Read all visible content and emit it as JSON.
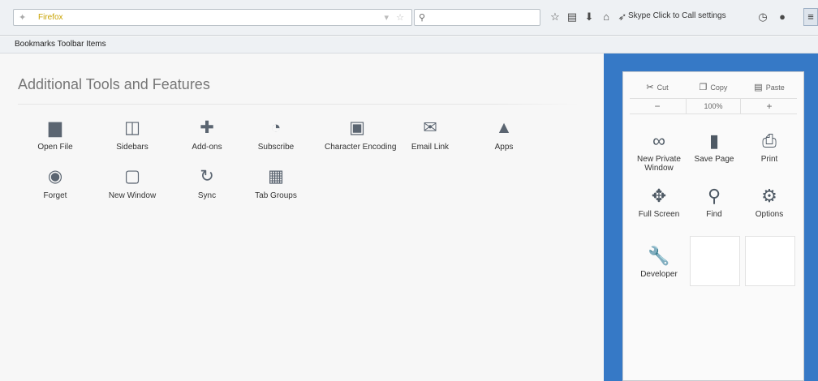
{
  "navbar": {
    "url_icon": "firefox-icon",
    "url_text": "Firefox",
    "url_controls": "▾ ☆",
    "search_icon": "search-icon",
    "skype_label": "Skype Click to Call settings",
    "menu_icon": "hamburger-menu-icon"
  },
  "bookmarks": {
    "label": "Bookmarks Toolbar Items"
  },
  "customize": {
    "title": "Additional Tools and Features",
    "items": [
      {
        "label": "Open File",
        "icon": "folder-icon",
        "glyph": "▆"
      },
      {
        "label": "Sidebars",
        "icon": "sidebar-icon",
        "glyph": "◫"
      },
      {
        "label": "Add-ons",
        "icon": "puzzle-icon",
        "glyph": "✚"
      },
      {
        "label": "Subscribe",
        "icon": "rss-icon",
        "glyph": "◔"
      },
      {
        "label": "Character Encoding",
        "icon": "encoding-icon",
        "glyph": "▣"
      },
      {
        "label": "Email Link",
        "icon": "envelope-icon",
        "glyph": "✉"
      },
      {
        "label": "Apps",
        "icon": "rocket-icon",
        "glyph": "▲"
      },
      {
        "label": "Forget",
        "icon": "forget-icon",
        "glyph": "◉"
      },
      {
        "label": "New Window",
        "icon": "window-icon",
        "glyph": "▢"
      },
      {
        "label": "Sync",
        "icon": "sync-icon",
        "glyph": "↻"
      },
      {
        "label": "Tab Groups",
        "icon": "tab-groups-icon",
        "glyph": "▦"
      }
    ]
  },
  "panel": {
    "cut": "Cut",
    "copy": "Copy",
    "paste": "Paste",
    "zoom_out": "−",
    "zoom_level": "100%",
    "zoom_in": "+",
    "items": [
      {
        "label": "New Private Window",
        "icon": "mask-icon",
        "glyph": "∞"
      },
      {
        "label": "Save Page",
        "icon": "save-page-icon",
        "glyph": "▮"
      },
      {
        "label": "Print",
        "icon": "printer-icon",
        "glyph": "⎙"
      },
      {
        "label": "Full Screen",
        "icon": "fullscreen-icon",
        "glyph": "✥"
      },
      {
        "label": "Find",
        "icon": "find-icon",
        "glyph": "⚲"
      },
      {
        "label": "Options",
        "icon": "gear-icon",
        "glyph": "⚙"
      },
      {
        "label": "Developer",
        "icon": "wrench-icon",
        "glyph": "🔧"
      }
    ]
  }
}
